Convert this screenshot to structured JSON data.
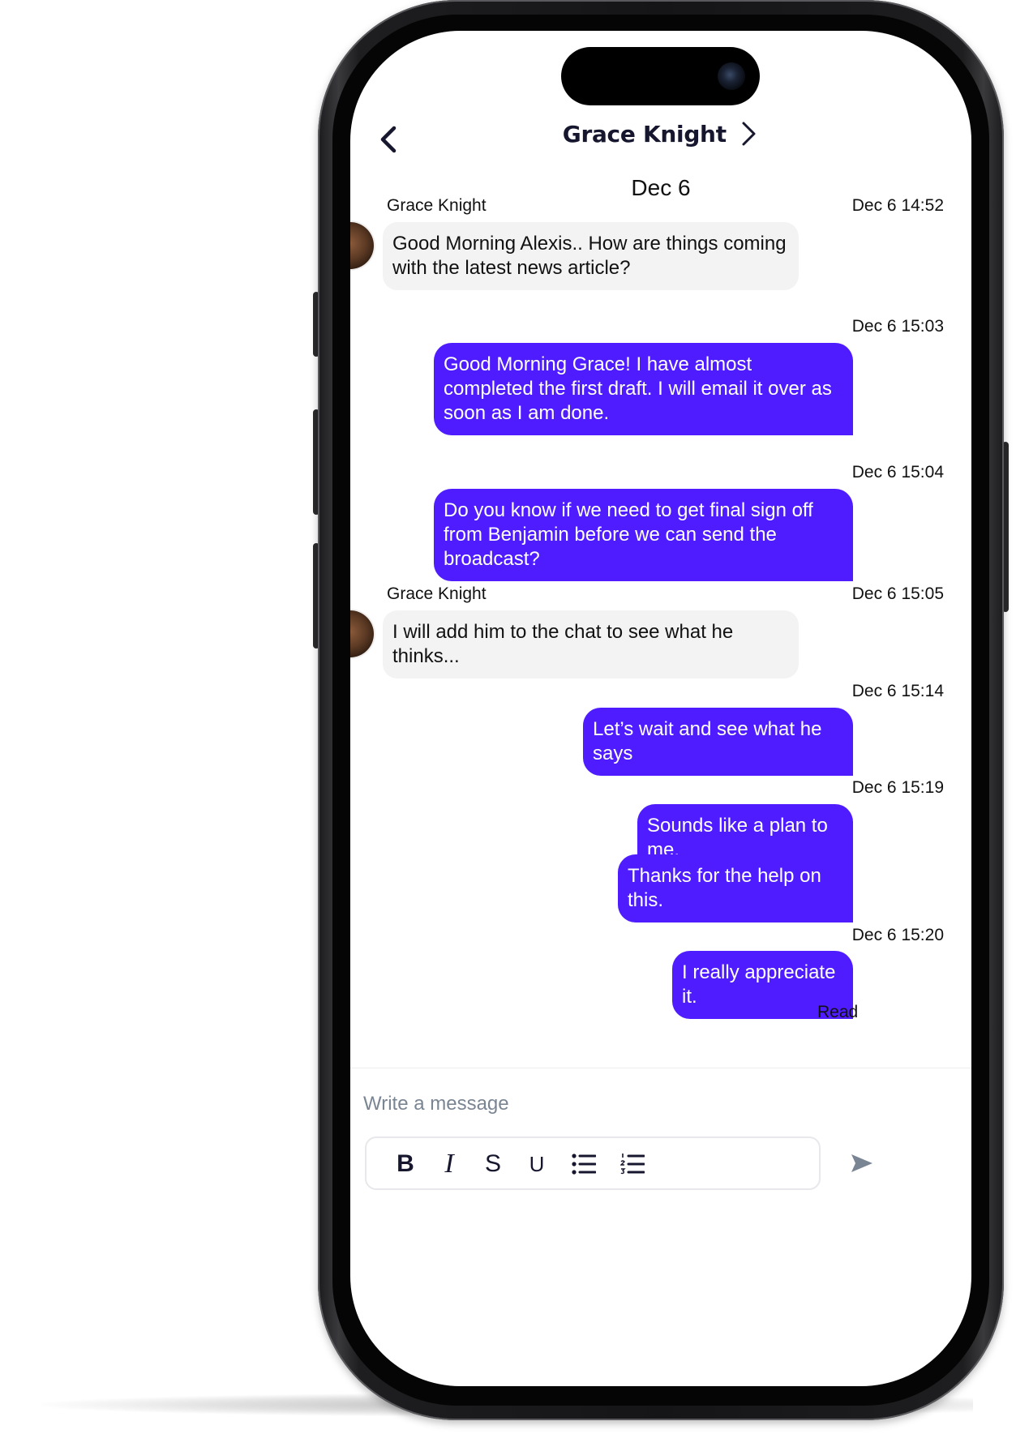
{
  "header": {
    "contact_name": "Grace Knight"
  },
  "date_separator": "Dec 6",
  "messages": [
    {
      "sender": "Grace Knight",
      "time": "Dec  6  14:52",
      "text": "Good Morning Alexis.. How are things coming with the latest news article?"
    },
    {
      "time": "Dec  6  15:03",
      "text": "Good Morning Grace! I have almost completed the first draft. I will email it over as soon as I am done."
    },
    {
      "time": "Dec  6  15:04",
      "text": "Do you know if we need to get final sign off from Benjamin before we can send the broadcast?"
    },
    {
      "sender": "Grace Knight",
      "time": "Dec  6  15:05",
      "text": "I will add him to the chat to see what he thinks..."
    },
    {
      "time": "Dec  6  15:14",
      "text": "Let’s wait and see what he says"
    },
    {
      "time": "Dec  6  15:19",
      "text": "Sounds like a plan to me."
    },
    {
      "text": "Thanks for the help on this."
    },
    {
      "time": "Dec  6  15:20",
      "text": "I really appreciate it."
    }
  ],
  "read_receipt": "Read",
  "composer": {
    "placeholder": "Write a message",
    "format_bold": "B",
    "format_italic": "I",
    "format_strike": "S",
    "format_underline": "U"
  },
  "icons": {
    "back": "chevron-left-icon",
    "contact_info": "chevron-right-icon",
    "bullet_list": "bullet-list-icon",
    "numbered_list": "numbered-list-icon",
    "send": "send-icon"
  },
  "colors": {
    "outgoing_bubble": "#4f1cff",
    "incoming_bubble": "#f3f3f3",
    "title": "#16162e",
    "placeholder": "#7a8594"
  }
}
